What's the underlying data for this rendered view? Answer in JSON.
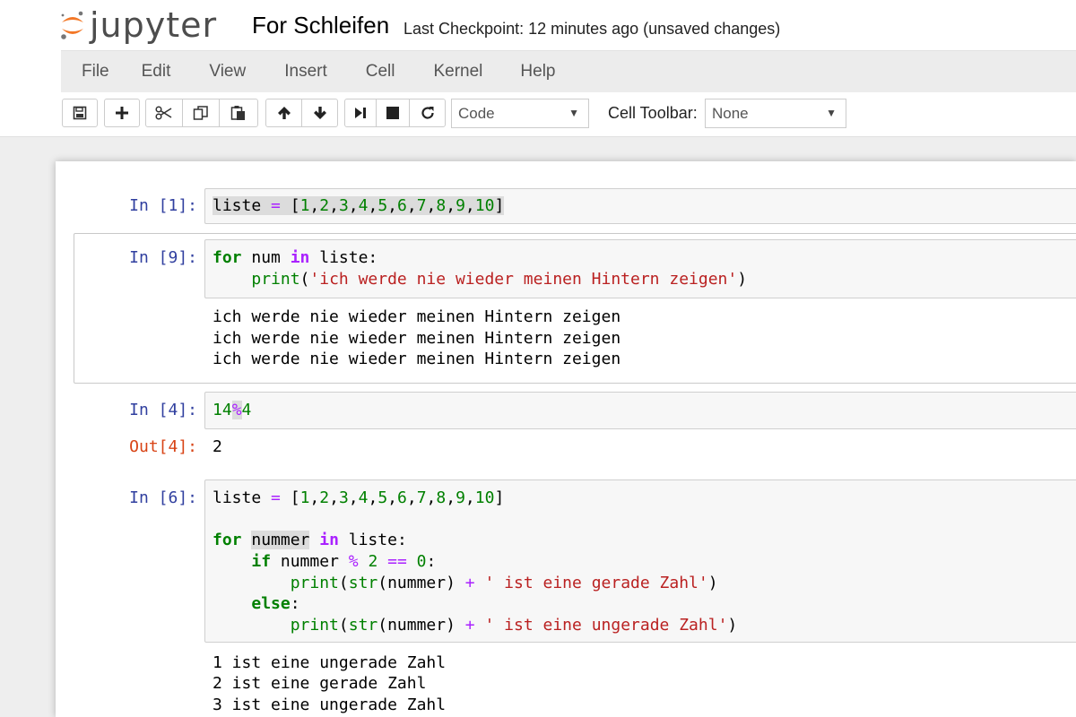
{
  "header": {
    "logo_text": "jupyter",
    "notebook_name": "For Schleifen",
    "checkpoint": "Last Checkpoint: 12 minutes ago (unsaved changes)",
    "logo_colors": {
      "orange": "#f37726",
      "gray": "#767677"
    }
  },
  "menu": {
    "items": [
      "File",
      "Edit",
      "View",
      "Insert",
      "Cell",
      "Kernel",
      "Help"
    ]
  },
  "toolbar": {
    "icons": [
      "save-icon",
      "plus-icon",
      "cut-icon",
      "copy-icon",
      "paste-icon",
      "arrow-up-icon",
      "arrow-down-icon",
      "run-icon",
      "stop-icon",
      "restart-icon"
    ],
    "cell_type": "Code",
    "cell_toolbar_label": "Cell Toolbar:",
    "cell_toolbar_value": "None"
  },
  "cells": [
    {
      "prompt": "In [1]:",
      "input": [
        "liste = [1,2,3,4,5,6,7,8,9,10]"
      ],
      "output": []
    },
    {
      "prompt": "In [9]:",
      "input": [
        "for num in liste:",
        "    print('ich werde nie wieder meinen Hintern zeigen')"
      ],
      "output": [
        "ich werde nie wieder meinen Hintern zeigen",
        "ich werde nie wieder meinen Hintern zeigen",
        "ich werde nie wieder meinen Hintern zeigen"
      ]
    },
    {
      "prompt": "In [4]:",
      "input": [
        "14%4"
      ],
      "out_prompt": "Out[4]:",
      "output": [
        "2"
      ]
    },
    {
      "prompt": "In [6]:",
      "input": [
        "liste = [1,2,3,4,5,6,7,8,9,10]",
        "",
        "for nummer in liste:",
        "    if nummer % 2 == 0:",
        "        print(str(nummer) + ' ist eine gerade Zahl')",
        "    else:",
        "        print(str(nummer) + ' ist eine ungerade Zahl')"
      ],
      "output": [
        "1 ist eine ungerade Zahl",
        "2 ist eine gerade Zahl",
        "3 ist eine ungerade Zahl"
      ]
    }
  ],
  "syntax_colors": {
    "keyword": "#008000",
    "number": "#008000",
    "string": "#ba2121",
    "operator": "#aa22ff",
    "in_prompt": "#303f9f",
    "out_prompt": "#d84315"
  }
}
